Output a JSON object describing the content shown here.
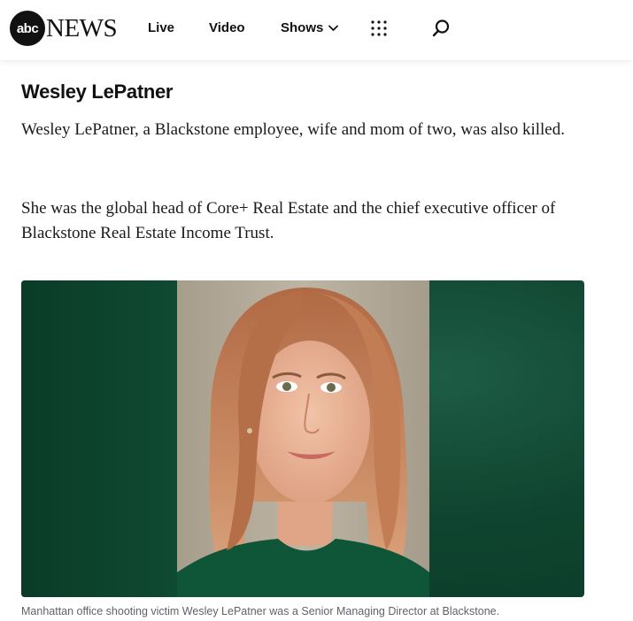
{
  "header": {
    "logo_abc": "abc",
    "logo_news": "NEWS",
    "nav": {
      "live": "Live",
      "video": "Video",
      "shows": "Shows"
    }
  },
  "article": {
    "heading": "Wesley LePatner",
    "paragraph_1": "Wesley LePatner, a Blackstone employee, wife and mom of two, was also killed.",
    "paragraph_2": "She was the global head of Core+ Real Estate and the chief executive officer of Blackstone Real Estate Income Trust.",
    "photo_caption": "Manhattan office shooting victim Wesley LePatner was a Senior Managing Director at Blackstone."
  },
  "icons": {
    "chevron": "chevron-down-icon",
    "grid": "grid-menu-icon",
    "search": "search-icon"
  },
  "colors": {
    "photo_background": "#0f4530",
    "inner_backdrop": "#b3aa9a",
    "caption_text": "#5f6368"
  }
}
